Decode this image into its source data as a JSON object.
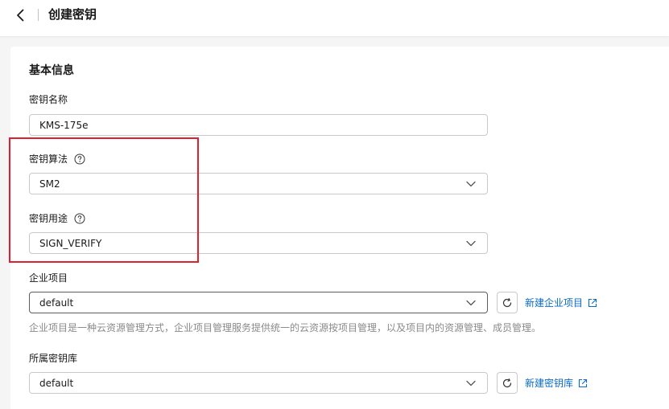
{
  "header": {
    "title": "创建密钥"
  },
  "form": {
    "section_title": "基本信息",
    "key_name": {
      "label": "密钥名称",
      "value": "KMS-175e"
    },
    "key_algorithm": {
      "label": "密钥算法",
      "value": "SM2"
    },
    "key_usage": {
      "label": "密钥用途",
      "value": "SIGN_VERIFY"
    },
    "enterprise_project": {
      "label": "企业项目",
      "value": "default",
      "link": "新建企业项目",
      "hint": "企业项目是一种云资源管理方式，企业项目管理服务提供统一的云资源按项目管理，以及项目内的资源管理、成员管理。"
    },
    "keystore": {
      "label": "所属密钥库",
      "value": "default",
      "link": "新建密钥库"
    }
  },
  "colors": {
    "highlight": "#e0202a",
    "link": "#0b6bcb"
  }
}
